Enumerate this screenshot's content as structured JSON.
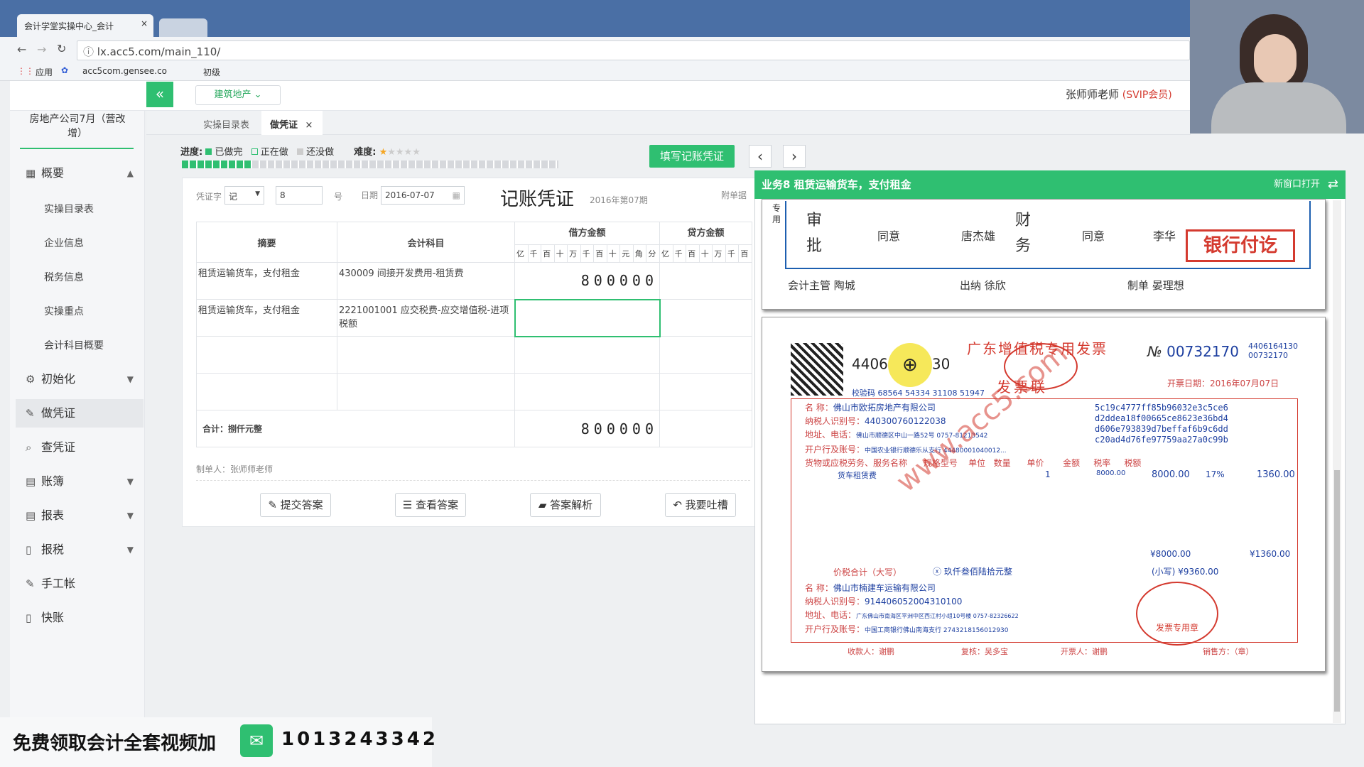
{
  "browser": {
    "tab_title": "会计学堂实操中心_会计",
    "url": "lx.acc5.com/main_110/",
    "bookmarks": [
      "应用",
      "acc5com.gensee.co",
      "初级"
    ]
  },
  "header": {
    "collapse_icon": "«",
    "industry": "建筑地产 ⌄",
    "user_name": "张师师老师",
    "user_level": "(SVIP会员)"
  },
  "sidebar": {
    "company": "房地产公司7月（营改增）",
    "nav": [
      {
        "label": "概要",
        "icon": "grid-icon"
      },
      {
        "label": "初始化",
        "icon": "gear-icon"
      },
      {
        "label": "做凭证",
        "icon": "pen-icon"
      },
      {
        "label": "查凭证",
        "icon": "search-icon"
      },
      {
        "label": "账簿",
        "icon": "book-icon"
      },
      {
        "label": "报表",
        "icon": "report-icon"
      },
      {
        "label": "报税",
        "icon": "file-icon"
      },
      {
        "label": "手工帐",
        "icon": "pen-icon"
      },
      {
        "label": "快账",
        "icon": "file-icon"
      }
    ],
    "overview_sub": [
      "实操目录表",
      "企业信息",
      "税务信息",
      "实操重点",
      "会计科目概要"
    ]
  },
  "tabs": {
    "t1": "实操目录表",
    "t2": "做凭证",
    "close": "×"
  },
  "progress": {
    "label": "进度:",
    "done": "已做完",
    "doing": "正在做",
    "todo": "还没做",
    "difficulty": "难度:",
    "fill_button": "填写记账凭证",
    "prev": "‹",
    "next": "›"
  },
  "voucher": {
    "word_label": "凭证字",
    "word_value": "记",
    "number": "8",
    "number_suffix": "号",
    "date_label": "日期",
    "date_value": "2016-07-07",
    "title": "记账凭证",
    "period": "2016年第07期",
    "attach_label": "附单据",
    "col_summary": "摘要",
    "col_account": "会计科目",
    "col_debit": "借方金额",
    "col_credit": "贷方金额",
    "units": [
      "亿",
      "千",
      "百",
      "十",
      "万",
      "千",
      "百",
      "十",
      "元",
      "角",
      "分"
    ],
    "units_credit": [
      "亿",
      "千",
      "百",
      "十",
      "万",
      "千",
      "百"
    ],
    "rows": [
      {
        "summary": "租赁运输货车，支付租金",
        "account": "430009 间接开发费用-租赁费",
        "debit": "800000"
      },
      {
        "summary": "租赁运输货车，支付租金",
        "account": "2221001001 应交税费-应交增值税-进项税额",
        "debit": ""
      }
    ],
    "total_label": "合计：捌仟元整",
    "total": "800000",
    "maker": "制单人：张师师老师"
  },
  "actions": [
    "提交答案",
    "查看答案",
    "答案解析",
    "我要吐槽"
  ],
  "viewer": {
    "title": "业务8 租赁运输货车，支付租金",
    "open_new": "新窗口打开",
    "approval": {
      "special": "专用",
      "shen": "审批",
      "agree1": "同意",
      "name1": "唐杰雄",
      "cai": "财务",
      "agree2": "同意",
      "name2": "李华",
      "stamp": "银行付讫",
      "supervisor": "会计主管",
      "supervisor_name": "陶城",
      "cashier": "出纳",
      "cashier_name": "徐欣",
      "maker": "制单",
      "maker_name": "晏理想"
    },
    "invoice": {
      "code_prefix": "4406",
      "code_suffix": "30",
      "title": "广东增值税专用发票",
      "subtitle": "发票联",
      "no_label": "№",
      "no": "00732170",
      "code_side": "4406164130",
      "no_side": "00732170",
      "date": "开票日期：2016年07月07日",
      "check": "校验码 68564 54334 31108 51947",
      "buyer_name": "佛山市欧拓房地产有限公司",
      "buyer_tax": "440300760122038",
      "buyer_addr": "佛山市顺德区中山一路52号 0757-81213542",
      "buyer_bank": "中国农业银行顺德乐从支行 44480001040012...",
      "cipher": [
        "5c19c4777ff85b96032e3c5ce6",
        "d2ddea18f00665ce8623e36bd4",
        "d606e793839d7beffaf6b9c6dd",
        "c20ad4d76fe97759aa27a0c99b"
      ],
      "item_name": "货车租赁费",
      "qty": "1",
      "price": "8000.00",
      "amount": "8000.00",
      "rate": "17%",
      "tax": "1360.00",
      "total_amount": "¥8000.00",
      "total_tax": "¥1360.00",
      "total_upper_label": "价税合计（大写）",
      "total_upper": "ⓧ 玖仟叁佰陆拾元整",
      "total_lower": "(小写) ¥9360.00",
      "seller_name": "佛山市楠建车运输有限公司",
      "seller_tax": "914406052004310100",
      "seller_addr": "广东佛山市南海区平洲中区西江村小组10号楼 0757-82326622",
      "seller_bank": "中国工商银行佛山南海支行 2743218156012930",
      "payee": "收款人：谢鹏",
      "reviewer": "复核：吴多宝",
      "issuer": "开票人：谢鹏",
      "seller_seal": "销售方：（章）",
      "stamp_text": "发票专用章",
      "watermark": "www.acc5.com"
    }
  },
  "promo": {
    "text": "免费领取会计全套视频加",
    "number": "1013243342"
  },
  "colors": {
    "green": "#2fbf71",
    "red": "#d43a2f"
  }
}
